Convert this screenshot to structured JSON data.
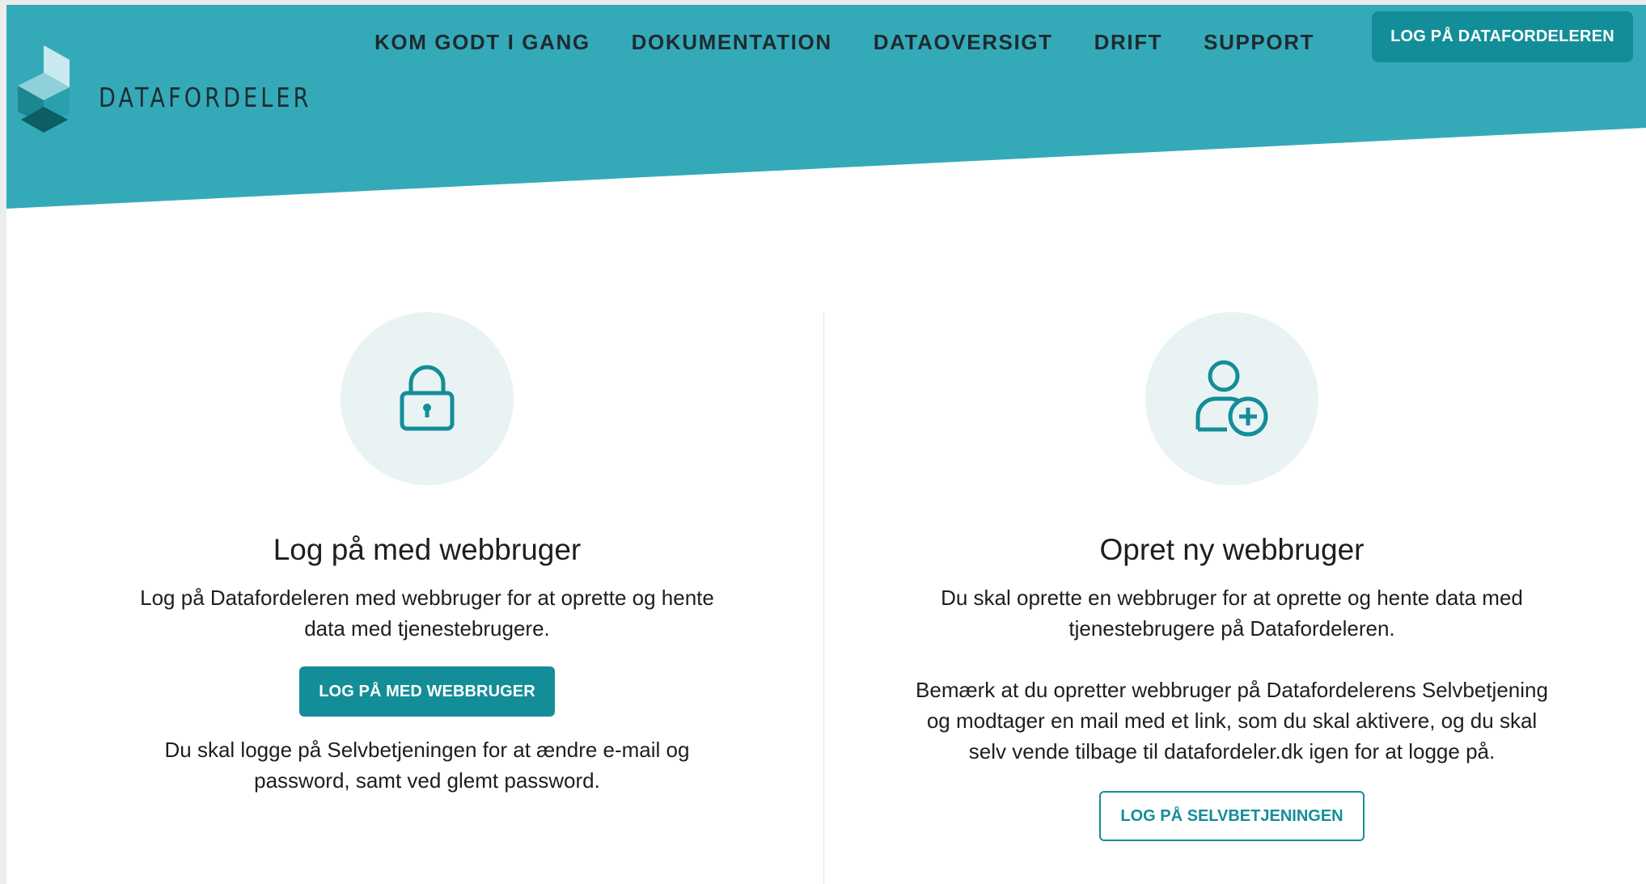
{
  "colors": {
    "header": "#34aab8",
    "accent": "#138e98",
    "icon_bg": "#eaf3f4"
  },
  "brand": {
    "name": "DATAFORDELER",
    "logo_icon": "stacked-cubes-logo-icon"
  },
  "nav": {
    "items": [
      {
        "label": "KOM GODT I GANG"
      },
      {
        "label": "DOKUMENTATION"
      },
      {
        "label": "DATAOVERSIGT"
      },
      {
        "label": "DRIFT"
      },
      {
        "label": "SUPPORT"
      }
    ],
    "login_button": "LOG PÅ DATAFORDELEREN"
  },
  "login_section": {
    "icon": "lock-icon",
    "title": "Log på med webbruger",
    "description": "Log på Datafordeleren med webbruger for at oprette og hente data med tjenestebrugere.",
    "button": "LOG PÅ MED WEBBRUGER",
    "note": "Du skal logge på Selvbetjeningen for at ændre e-mail og password, samt ved glemt password."
  },
  "create_section": {
    "icon": "add-user-icon",
    "title": "Opret ny webbruger",
    "description": "Du skal oprette en webbruger for at oprette og hente data med tjenestebrugere på Datafordeleren.",
    "note": "Bemærk at du opretter webbruger på Datafordelerens Selvbetjening og modtager en mail med et link, som du skal aktivere, og du skal selv vende tilbage til datafordeler.dk igen for at logge på.",
    "button": "LOG PÅ SELVBETJENINGEN"
  }
}
